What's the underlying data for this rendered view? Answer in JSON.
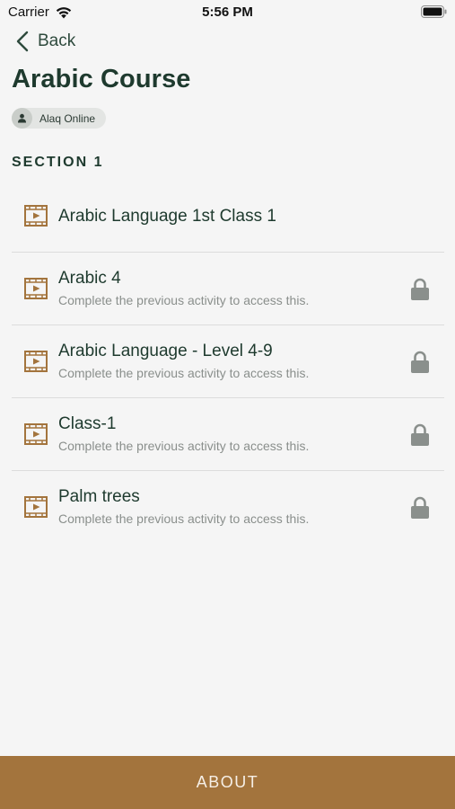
{
  "status_bar": {
    "carrier": "Carrier",
    "time": "5:56 PM"
  },
  "nav": {
    "back_label": "Back"
  },
  "course": {
    "title": "Arabic Course",
    "author": "Alaq Online"
  },
  "section": {
    "title": "SECTION 1"
  },
  "activities": [
    {
      "title": "Arabic Language 1st Class 1",
      "subtitle": "",
      "locked": false
    },
    {
      "title": "Arabic 4",
      "subtitle": "Complete the previous activity to access this.",
      "locked": true
    },
    {
      "title": "Arabic Language - Level 4-9",
      "subtitle": "Complete the previous activity to access this.",
      "locked": true
    },
    {
      "title": "Class-1",
      "subtitle": "Complete the previous activity to access this.",
      "locked": true
    },
    {
      "title": "Palm trees",
      "subtitle": "Complete the previous activity to access this.",
      "locked": true
    }
  ],
  "footer": {
    "about_label": "ABOUT"
  },
  "colors": {
    "primary_green": "#1e3a2e",
    "accent_brown": "#a3743d",
    "muted_gray": "#8a8f8c"
  },
  "icons": {
    "activity": "video-icon",
    "locked": "lock-icon",
    "back": "chevron-left-icon",
    "author": "person-icon"
  }
}
